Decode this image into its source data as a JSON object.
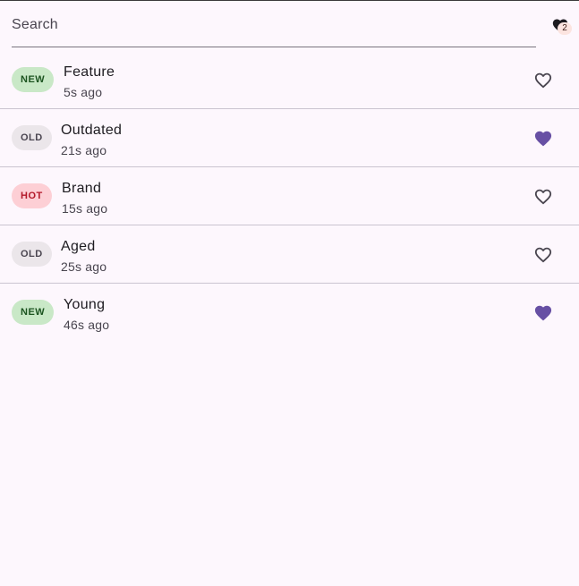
{
  "search": {
    "placeholder": "Search"
  },
  "favorites": {
    "count": "2",
    "icon": "heart-icon"
  },
  "colors": {
    "accent": "#6750a4",
    "new": "#c9e8c7",
    "old": "#ebe6ea",
    "hot": "#fdcfd5"
  },
  "items": [
    {
      "tag": "NEW",
      "title": "Feature",
      "subtitle": "5s ago",
      "favorite": false
    },
    {
      "tag": "OLD",
      "title": "Outdated",
      "subtitle": "21s ago",
      "favorite": true
    },
    {
      "tag": "HOT",
      "title": "Brand",
      "subtitle": "15s ago",
      "favorite": false
    },
    {
      "tag": "OLD",
      "title": "Aged",
      "subtitle": "25s ago",
      "favorite": false
    },
    {
      "tag": "NEW",
      "title": "Young",
      "subtitle": "46s ago",
      "favorite": true
    }
  ]
}
